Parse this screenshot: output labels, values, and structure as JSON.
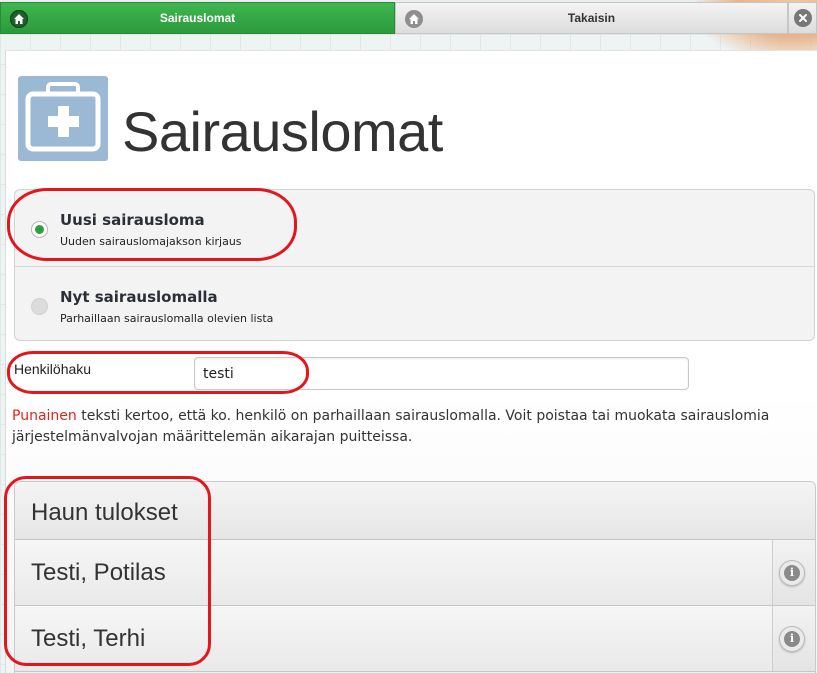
{
  "tabs": {
    "active_label": "Sairauslomat",
    "back_label": "Takaisin"
  },
  "page": {
    "title": "Sairauslomat"
  },
  "options": [
    {
      "title": "Uusi sairausloma",
      "description": "Uuden sairauslomajakson kirjaus",
      "selected": true
    },
    {
      "title": "Nyt sairauslomalla",
      "description": "Parhaillaan sairauslomalla olevien lista",
      "selected": false
    }
  ],
  "search": {
    "label": "Henkilöhaku",
    "value": "testi"
  },
  "info": {
    "red_word": "Punainen",
    "text": " teksti kertoo, että ko. henkilö on parhaillaan sairauslomalla. Voit poistaa tai muokata sairauslomia järjestelmänvalvojan määrittelemän aikarajan puitteissa."
  },
  "results": {
    "header": "Haun tulokset",
    "items": [
      "Testi, Potilas",
      "Testi, Terhi"
    ]
  },
  "colors": {
    "accent_green": "#2f9e40",
    "warning_red": "#e0251b",
    "icon_blue": "#9bb8d4"
  }
}
